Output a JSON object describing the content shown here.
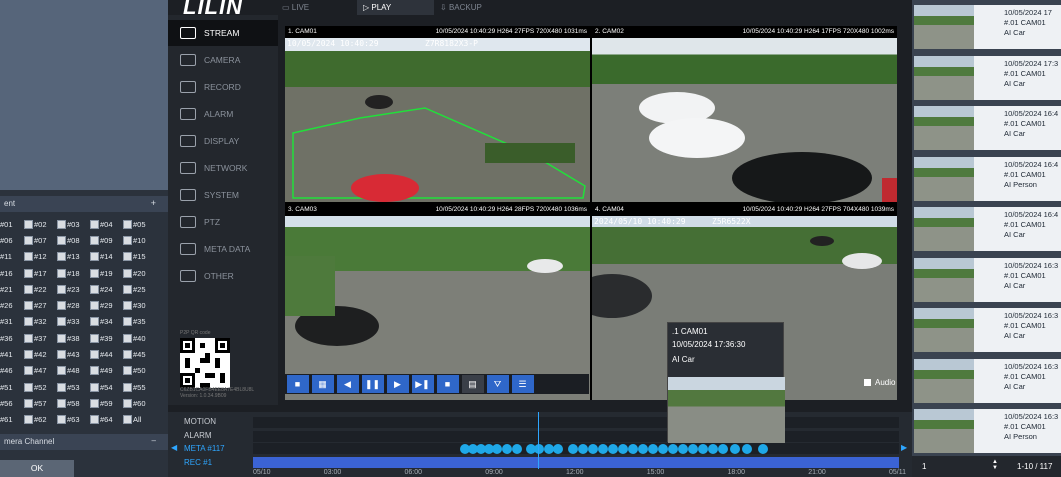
{
  "header": {
    "logo": "LILIN",
    "tabs": [
      "LIVE",
      "PLAY",
      "BACKUP"
    ]
  },
  "left_panel": {
    "section_label": "ent",
    "plus": "+",
    "channels": [
      [
        "#01",
        "#02",
        "#03",
        "#04",
        "#05"
      ],
      [
        "#06",
        "#07",
        "#08",
        "#09",
        "#10"
      ],
      [
        "#11",
        "#12",
        "#13",
        "#14",
        "#15"
      ],
      [
        "#16",
        "#17",
        "#18",
        "#19",
        "#20"
      ],
      [
        "#21",
        "#22",
        "#23",
        "#24",
        "#25"
      ],
      [
        "#26",
        "#27",
        "#28",
        "#29",
        "#30"
      ],
      [
        "#31",
        "#32",
        "#33",
        "#34",
        "#35"
      ],
      [
        "#36",
        "#37",
        "#38",
        "#39",
        "#40"
      ],
      [
        "#41",
        "#42",
        "#43",
        "#44",
        "#45"
      ],
      [
        "#46",
        "#47",
        "#48",
        "#49",
        "#50"
      ],
      [
        "#51",
        "#52",
        "#53",
        "#54",
        "#55"
      ],
      [
        "#56",
        "#57",
        "#58",
        "#59",
        "#60"
      ],
      [
        "#61",
        "#62",
        "#63",
        "#64",
        "All"
      ]
    ],
    "camera_channel_label": "mera Channel",
    "minus": "–",
    "ok_button": "OK"
  },
  "nav": {
    "items": [
      "STREAM",
      "CAMERA",
      "RECORD",
      "ALARM",
      "DISPLAY",
      "NETWORK",
      "SYSTEM",
      "PTZ",
      "META DATA",
      "OTHER"
    ],
    "qr_label": "P2P QR code",
    "version_mac": "C6ZB1CA0FB4EE8A7E4BL8U8L",
    "version": "Version: 1.0.34.9B09"
  },
  "cameras": [
    {
      "name": "1. CAM01",
      "info": "10/05/2024 10:40:29  H264 27FPS 720X480 1031ms",
      "osd_time": "10/05/2024 10:40:29",
      "osd_plate": "Z7R8182X3-P"
    },
    {
      "name": "2. CAM02",
      "info": "10/05/2024 10:40:29  H264 17FPS 720X480 1002ms",
      "osd_time": "",
      "osd_plate": ""
    },
    {
      "name": "3. CAM03",
      "info": "10/05/2024 10:40:29  H264 28FPS 720X480 1036ms",
      "osd_time": "",
      "osd_plate": ""
    },
    {
      "name": "4. CAM04",
      "info": "10/05/2024 10:40:29  H264 27FPS 704X480 1039ms",
      "osd_time": "2024/05/10 10:40:29",
      "osd_plate": "Z5R6522X"
    }
  ],
  "controls": {
    "audio_label": "Audio"
  },
  "timeline": {
    "rows": [
      "MOTION",
      "ALARM",
      "META #117",
      "REC #1"
    ],
    "ticks": [
      "05/10",
      "03:00",
      "06:00",
      "09:00",
      "12:00",
      "15:00",
      "18:00",
      "21:00",
      "05/11"
    ]
  },
  "popup": {
    "cam": ".1 CAM01",
    "time": "10/05/2024 17:36:30",
    "type": "AI Car"
  },
  "events": [
    {
      "time": "10/05/2024 17",
      "cam": "#.01 CAM01",
      "type": "AI Car"
    },
    {
      "time": "10/05/2024 17:3",
      "cam": "#.01 CAM01",
      "type": "AI Car"
    },
    {
      "time": "10/05/2024 16:4",
      "cam": "#.01 CAM01",
      "type": "AI Car"
    },
    {
      "time": "10/05/2024 16:4",
      "cam": "#.01 CAM01",
      "type": "AI Person"
    },
    {
      "time": "10/05/2024 16:4",
      "cam": "#.01 CAM01",
      "type": "AI Car"
    },
    {
      "time": "10/05/2024 16:3",
      "cam": "#.01 CAM01",
      "type": "AI Car"
    },
    {
      "time": "10/05/2024 16:3",
      "cam": "#.01 CAM01",
      "type": "AI Car"
    },
    {
      "time": "10/05/2024 16:3",
      "cam": "#.01 CAM01",
      "type": "AI Car"
    },
    {
      "time": "10/05/2024 16:3",
      "cam": "#.01 CAM01",
      "type": "AI Person"
    }
  ],
  "pager": {
    "page": "1",
    "range": "1-10 / 117"
  },
  "colors": {
    "accent": "#2f67c9",
    "meta_dot": "#1fa8e8",
    "rec_bar": "#3b63d4"
  }
}
